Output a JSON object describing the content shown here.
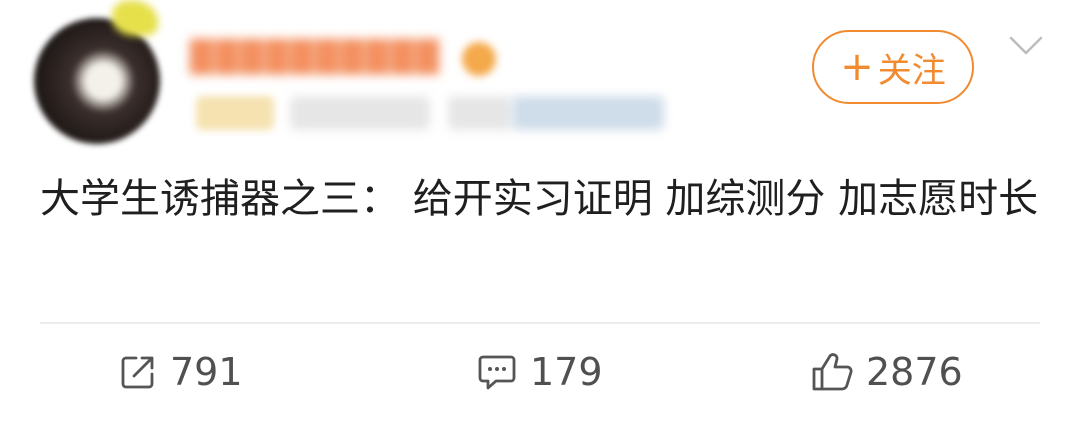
{
  "post": {
    "follow_label": "关注",
    "text": "大学生诱捕器之三： 给开实习证明 加综测分 加志愿时长"
  },
  "actions": {
    "repost_count": "791",
    "comment_count": "179",
    "like_count": "2876"
  },
  "icons": [
    "avatar",
    "chevron-down-icon",
    "share-icon",
    "comment-icon",
    "like-icon"
  ],
  "colors": {
    "accent": "#f28a30",
    "text": "#1f1f1f",
    "muted": "#505050",
    "divider": "#ececec"
  }
}
